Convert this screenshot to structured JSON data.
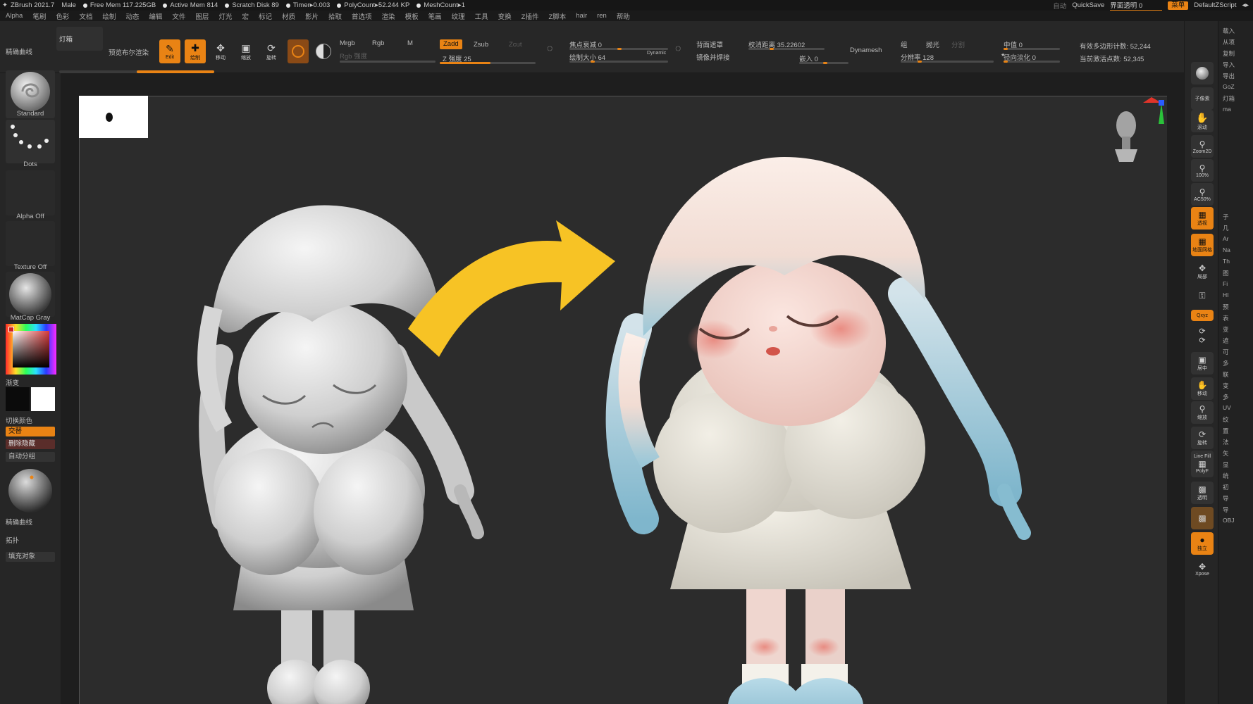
{
  "titlebar": {
    "app": "ZBrush 2021.7",
    "user": "Male",
    "free_mem": "Free Mem 117.225GB",
    "active_mem": "Active Mem 814",
    "scratch": "Scratch Disk 89",
    "timer": "Timer▸0.003",
    "polycount": "PolyCount▸52.244 KP",
    "meshcount": "MeshCount▸1",
    "auto": "自动",
    "quicksave": "QuickSave",
    "transparency": "界面透明 0",
    "menu": "菜单",
    "script": "DefaultZScript"
  },
  "menu": [
    "Alpha",
    "笔刷",
    "色彩",
    "文档",
    "绘制",
    "动态",
    "编辑",
    "文件",
    "图层",
    "灯光",
    "宏",
    "标记",
    "材质",
    "影片",
    "拾取",
    "首选项",
    "渲染",
    "模板",
    "笔画",
    "纹理",
    "工具",
    "变换",
    "Z插件",
    "Z脚本",
    "hair",
    "ren",
    "帮助"
  ],
  "shelf": {
    "curve_label": "精确曲线",
    "lightbox": "灯箱",
    "bpr": "预览布尔渲染",
    "edit": "Edit",
    "draw": "绘制",
    "move": "移动",
    "scale": "缩放",
    "rotate": "旋转",
    "mrgb": "Mrgb",
    "rgb": "Rgb",
    "m": "M",
    "rgb_intensity": "Rgb 强度",
    "zadd": "Zadd",
    "zsub": "Zsub",
    "zcut": "Zcut",
    "z_intensity": "Z 强度 25",
    "focal_shift": "焦点衰减 0",
    "draw_size": "绘制大小 64",
    "dynamic": "Dynamic",
    "backface": "背面遮罩",
    "mirror_weld": "镜像并焊接",
    "blur": "校消距离 35.22602",
    "embed": "嵌入 0",
    "dynamesh": "Dynamesh",
    "group": "组",
    "polish": "抛光",
    "split": "分割",
    "resolution": "分辨率 128",
    "median": "中值 0",
    "radial_fade": "径向淡化 0",
    "active_poly": "有效多边形计数: 52,244",
    "active_points": "当前激活点数: 52,345"
  },
  "left": {
    "brush": "Standard",
    "stroke": "Dots",
    "alpha": "Alpha Off",
    "texture": "Texture Off",
    "material": "MatCap Gray",
    "gradient": "渐变",
    "switch_color": "切换颜色",
    "alternate": "交替",
    "delete_hidden": "删除隐藏",
    "auto_group": "自动分组",
    "curve": "精确曲线",
    "topology": "拓扑",
    "fill_object": "填充对象"
  },
  "right": {
    "subpixel": "子像素",
    "scroll": "滚动",
    "zoom2d": "Zoom2D",
    "zoom100": "100%",
    "ac50": "AC50%",
    "perspective": "透视",
    "floor": "地面网格",
    "local": "局部",
    "lock": "锁定",
    "xyz": "Qxyz",
    "frame": "居中",
    "move": "移动",
    "zoom": "缩放",
    "rotate": "旋转",
    "linefill": "Line Fill",
    "polyf": "PolyF",
    "transp": "透明",
    "ghost": "幽灵",
    "solo": "独立",
    "xpose": "Xpose"
  },
  "far_right": [
    "载入",
    "从项",
    "复制",
    "导入",
    "导出",
    "GoZ",
    "灯箱",
    "ma"
  ],
  "far_right_lower": [
    "子",
    "几",
    "Ar",
    "Na",
    "Th",
    "图",
    "Fi",
    "HI",
    "预",
    "表",
    "变",
    "遮",
    "可",
    "多",
    "联",
    "变",
    "多",
    "UV",
    "纹",
    "置",
    "法",
    "矢",
    "显",
    "统",
    "初",
    "导",
    "导",
    "OBJ"
  ],
  "colors": {
    "accent": "#e98314",
    "arrow": "#f7c325",
    "hair_blue": "#8ec2d6",
    "cheek": "#e8847a"
  }
}
